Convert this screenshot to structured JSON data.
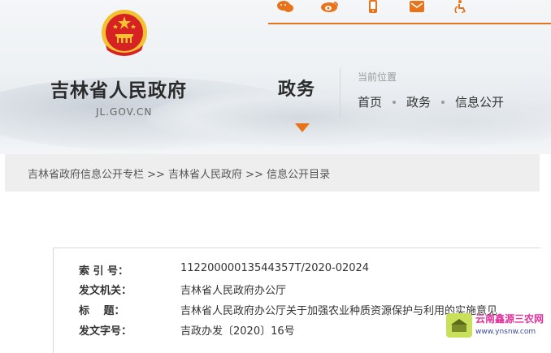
{
  "header": {
    "site_title": "吉林省人民政府",
    "site_domain": "JL.GOV.CN",
    "section_title": "政务",
    "location_label": "当前位置",
    "breadcrumb": [
      "首页",
      "政务",
      "信息公开"
    ],
    "social_icons": [
      "weibo-chat-icon",
      "weibo-icon",
      "mobile-icon",
      "email-icon",
      "accessibility-icon"
    ]
  },
  "path_bar": {
    "text": "吉林省政府信息公开专栏 >> 吉林省人民政府 >> 信息公开目录"
  },
  "document": {
    "rows": [
      {
        "label": "索 引 号：",
        "value": "11220000013544357T/2020-02024"
      },
      {
        "label": "发文机关：",
        "value": "吉林省人民政府办公厅"
      },
      {
        "label": "标　 题：",
        "value": "吉林省人民政府办公厅关于加强农业种质资源保护与利用的实施意见"
      },
      {
        "label": "发文字号：",
        "value": "吉政办发〔2020〕16号"
      }
    ]
  },
  "watermark": {
    "name": "云南鑫源三农网",
    "url": "www.ynsnw.com"
  },
  "colors": {
    "accent": "#e8731a",
    "emblem_red": "#d62222",
    "emblem_gold": "#f2c232"
  }
}
